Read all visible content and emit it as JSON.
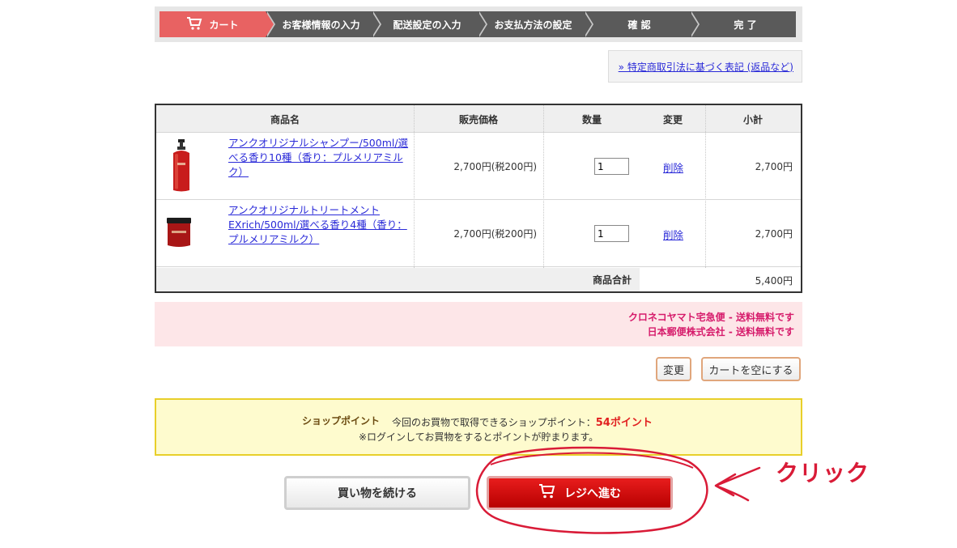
{
  "steps": [
    {
      "label": "カート",
      "active": true
    },
    {
      "label": "お客様情報の入力"
    },
    {
      "label": "配送設定の入力"
    },
    {
      "label": "お支払方法の設定"
    },
    {
      "label": "確 認"
    },
    {
      "label": "完 了"
    }
  ],
  "legal_link": "» 特定商取引法に基づく表記 (返品など)",
  "table": {
    "headers": {
      "name": "商品名",
      "price": "販売価格",
      "qty": "数量",
      "change": "変更",
      "subtotal": "小計"
    },
    "items": [
      {
        "name": "アンクオリジナルシャンプー/500ml/選べる香り10種（香り：プルメリアミルク）",
        "name_lines": [
          "アンクオリジナルシャンプー/500ml/選",
          "べる香り10種（香り：プルメリアミル",
          "ク）"
        ],
        "price": "2,700円(税200円)",
        "qty": "1",
        "delete": "削除",
        "subtotal": "2,700円",
        "image": "shampoo-bottle"
      },
      {
        "name": "アンクオリジナルトリートメントEXrich/500ml/選べる香り4種（香り：プルメリアミルク）",
        "name_lines": [
          "アンクオリジナルトリートメント",
          "EXrich/500ml/選べる香り4種（香り：",
          "プルメリアミルク）"
        ],
        "price": "2,700円(税200円)",
        "qty": "1",
        "delete": "削除",
        "subtotal": "2,700円",
        "image": "treatment-jar"
      }
    ],
    "total_label": "商品合計",
    "total_value": "5,400円"
  },
  "shipping": [
    "クロネコヤマト宅急便 - 送料無料です",
    "日本郵便株式会社 - 送料無料です"
  ],
  "buttons": {
    "change": "変更",
    "clear_cart": "カートを空にする",
    "continue": "買い物を続ける",
    "checkout": "レジへ進む"
  },
  "points": {
    "title": "ショップポイント",
    "text": "今回のお買物で取得できるショップポイント：",
    "value": "54ポイント",
    "note": "※ログインしてお買物をするとポイントが貯まります。"
  },
  "annotation": {
    "label": "クリック",
    "color": "#d91b37"
  },
  "colors": {
    "active_step": "#e86262",
    "step": "#5a5a5a",
    "checkout": "#d00000",
    "shipping_text": "#d61b6b",
    "points_value": "#e12020"
  },
  "icons": {
    "cart": "cart-icon"
  }
}
